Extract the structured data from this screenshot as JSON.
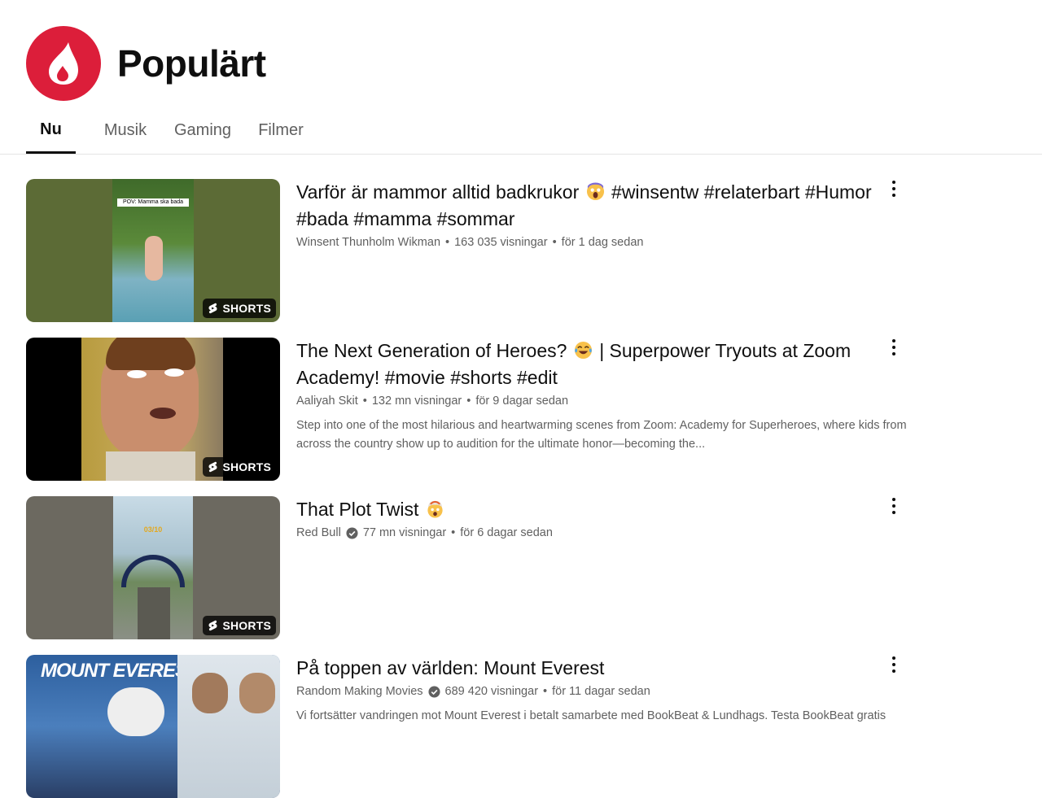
{
  "page": {
    "title": "Populärt"
  },
  "tabs": [
    "Nu",
    "Musik",
    "Gaming",
    "Filmer"
  ],
  "videos": [
    {
      "title_parts": [
        "Varför är mammor alltid badkrukor",
        "#winsentw #relaterbart #Humor #bada #mamma #sommar"
      ],
      "title_emoji": "face-screaming-emoji",
      "channel": "Winsent Thunholm Wikman",
      "verified": false,
      "views": "163 035 visningar",
      "age": "för 1 dag sedan",
      "description": "",
      "badge": "SHORTS",
      "thumb_caption": "POV: Mamma ska bada"
    },
    {
      "title_parts": [
        "The Next Generation of Heroes?",
        "| Superpower Tryouts at Zoom Academy! #movie #shorts #edit"
      ],
      "title_emoji": "tears-of-joy-emoji",
      "channel": "Aaliyah Skit",
      "verified": false,
      "views": "132 mn visningar",
      "age": "för 9 dagar sedan",
      "description": "Step into one of the most hilarious and heartwarming scenes from Zoom: Academy for Superheroes, where kids from across the country show up to audition for the ultimate honor—becoming the...",
      "badge": "SHORTS",
      "thumb_caption": ""
    },
    {
      "title_parts": [
        "That Plot Twist",
        ""
      ],
      "title_emoji": "exploding-head-emoji",
      "channel": "Red Bull",
      "verified": true,
      "views": "77 mn visningar",
      "age": "för 6 dagar sedan",
      "description": "",
      "badge": "SHORTS",
      "thumb_caption": "03/10"
    },
    {
      "title_parts": [
        "På toppen av världen: Mount Everest",
        ""
      ],
      "title_emoji": "",
      "channel": "Random Making Movies",
      "verified": true,
      "views": "689 420 visningar",
      "age": "för 11 dagar sedan",
      "description": "Vi fortsätter vandringen mot Mount Everest i betalt samarbete med BookBeat & Lundhags. Testa BookBeat gratis",
      "badge": "",
      "thumb_caption": "MOUNT EVEREST"
    }
  ],
  "colors": {
    "brand": "#dc1e3a",
    "meta": "#606060",
    "text": "#0f0f0f"
  }
}
